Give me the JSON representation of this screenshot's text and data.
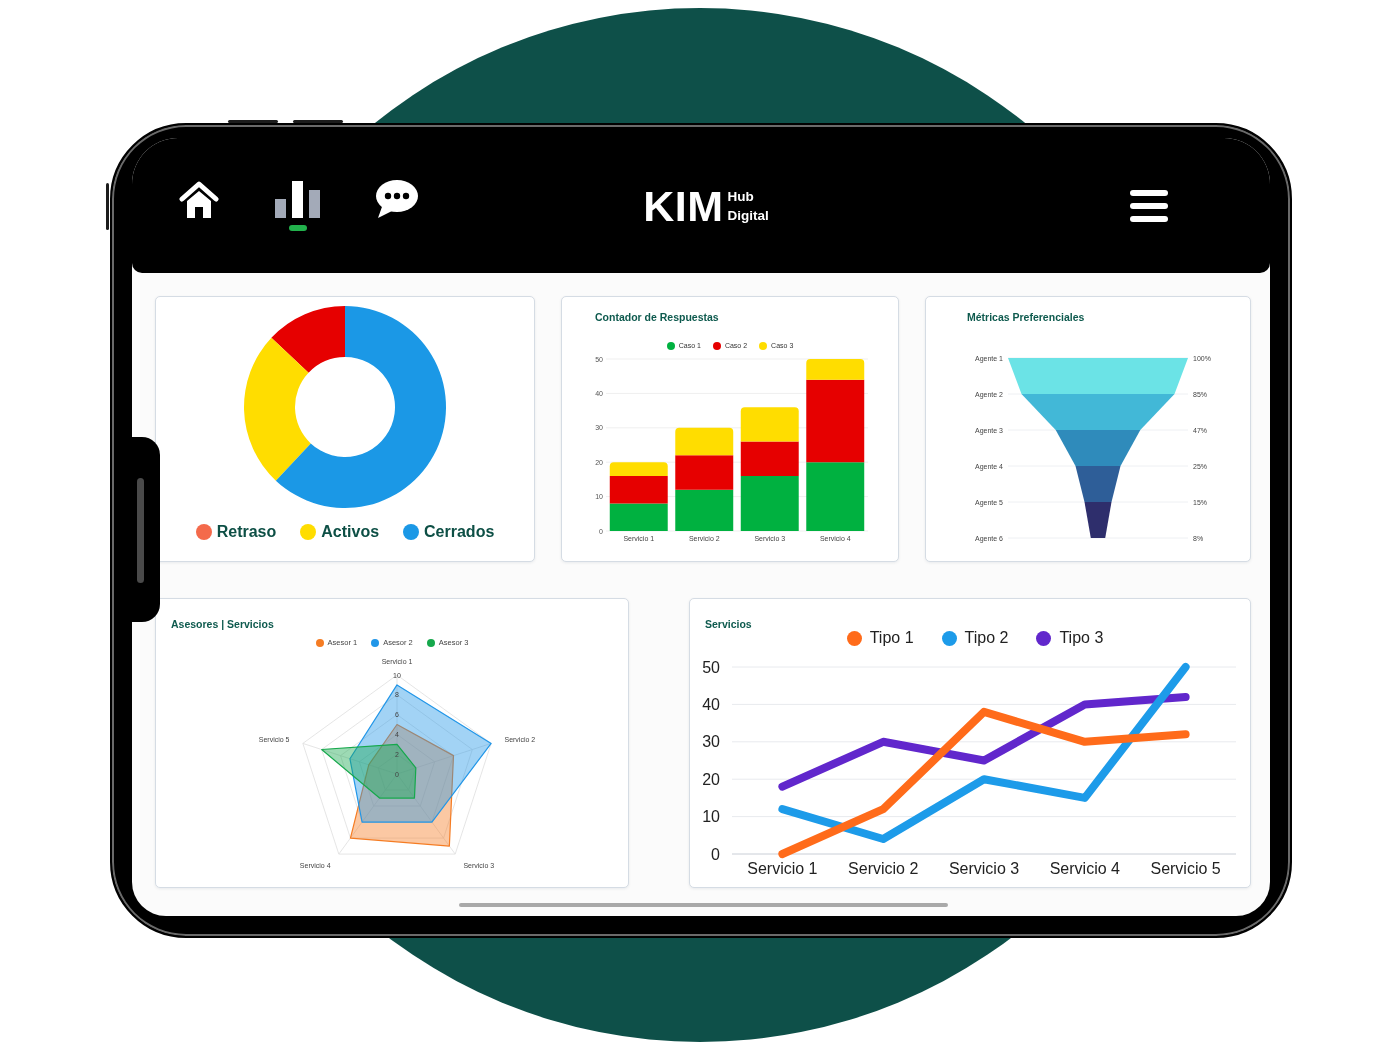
{
  "header": {
    "nav": [
      {
        "kind": "home",
        "selected": false
      },
      {
        "kind": "chart",
        "selected": true
      },
      {
        "kind": "chat",
        "selected": false
      }
    ],
    "logo": {
      "main": "KIM",
      "sub": [
        "Hub",
        "Digital"
      ]
    }
  },
  "status_card": {
    "chart_data": {
      "type": "donut",
      "values": [
        13,
        25,
        62
      ]
    },
    "legend": [
      {
        "label": "Retraso",
        "color": "#f46a4b"
      },
      {
        "label": "Activos",
        "color": "#ffdd00"
      },
      {
        "label": "Cerrados",
        "color": "#1b98e6"
      }
    ]
  },
  "responses_card": {
    "title": "Contador de Respuestas",
    "chart_data": {
      "type": "bar",
      "stacked": true,
      "legend": "top",
      "grid": true,
      "categories": [
        "Servicio 1",
        "Servicio 2",
        "Servicio 3",
        "Servicio 4"
      ],
      "series": [
        {
          "name": "Caso 1",
          "color": "#00b140",
          "values": [
            8,
            12,
            16,
            20
          ]
        },
        {
          "name": "Caso 2",
          "color": "#e60000",
          "values": [
            8,
            10,
            10,
            24
          ]
        },
        {
          "name": "Caso 3",
          "color": "#ffdd00",
          "values": [
            4,
            8,
            10,
            6
          ]
        }
      ],
      "ylim": [
        0,
        50
      ],
      "yticks": [
        0,
        10,
        20,
        30,
        40,
        50
      ]
    }
  },
  "preferences_card": {
    "title": "Métricas Preferenciales",
    "funnel": [
      {
        "label": "Agente 1",
        "value": "100%"
      },
      {
        "label": "Agente 2",
        "value": "85%"
      },
      {
        "label": "Agente 3",
        "value": "47%"
      },
      {
        "label": "Agente 4",
        "value": "25%"
      },
      {
        "label": "Agente 5",
        "value": "15%"
      },
      {
        "label": "Agente 6",
        "value": "8%"
      }
    ]
  },
  "advisors_card": {
    "title": "Asesores | Servicios",
    "chart_data": {
      "type": "radar",
      "legend": "top",
      "grid": true,
      "categories": [
        "Servicio 1",
        "Servicio 2",
        "Servicio 3",
        "Servicio 4",
        "Servicio 5"
      ],
      "series": [
        {
          "name": "Asesor 1",
          "color": "#f57c23",
          "values": [
            5,
            6,
            9,
            8,
            3
          ]
        },
        {
          "name": "Asesor 2",
          "color": "#2196e8",
          "values": [
            9,
            10,
            6,
            6,
            5
          ]
        },
        {
          "name": "Asesor 3",
          "color": "#16a84c",
          "values": [
            3,
            2,
            3,
            3,
            8
          ]
        }
      ],
      "ylim": [
        0,
        10
      ],
      "yticks": [
        0,
        2,
        4,
        6,
        8,
        10
      ]
    }
  },
  "services_card": {
    "title": "Servicios",
    "chart_data": {
      "type": "line",
      "legend": "top",
      "grid": true,
      "categories": [
        "Servicio 1",
        "Servicio 2",
        "Servicio 3",
        "Servicio 4",
        "Servicio 5"
      ],
      "series": [
        {
          "name": "Tipo 1",
          "color": "#ff6b1a",
          "values": [
            0,
            12,
            38,
            30,
            32
          ]
        },
        {
          "name": "Tipo 2",
          "color": "#1d9be9",
          "values": [
            12,
            4,
            20,
            15,
            50
          ]
        },
        {
          "name": "Tipo 3",
          "color": "#6127cc",
          "values": [
            18,
            30,
            25,
            40,
            42
          ]
        }
      ],
      "ylim": [
        0,
        50
      ],
      "yticks": [
        0,
        10,
        20,
        30,
        40,
        50
      ]
    }
  }
}
